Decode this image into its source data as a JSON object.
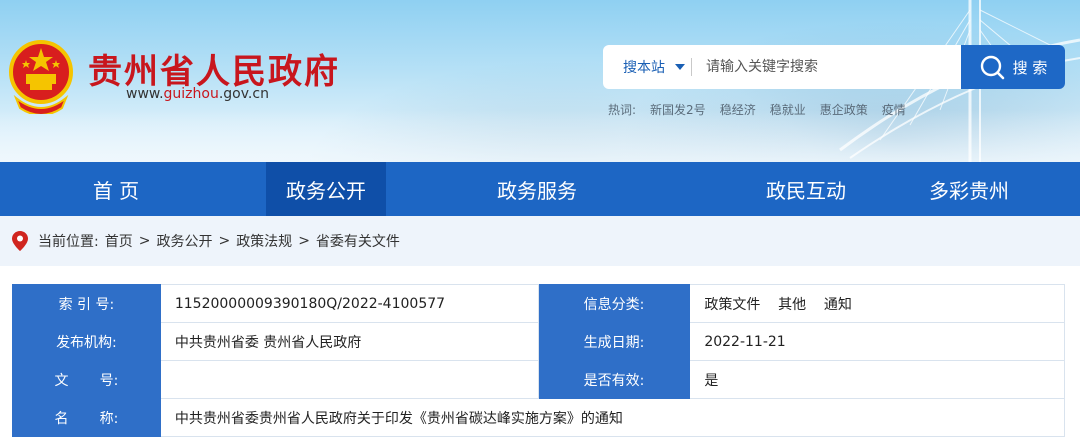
{
  "header": {
    "title": "贵州省人民政府",
    "url_prefix": "www.",
    "url_highlight": "guizhou",
    "url_suffix": ".gov.cn",
    "brand_red": "#c8161d"
  },
  "search": {
    "scope": "搜本站",
    "placeholder": "请输入关键字搜索",
    "button_label": "搜 索",
    "hot_label": "热词:",
    "hot_words": [
      "新国发2号",
      "稳经济",
      "稳就业",
      "惠企政策",
      "疫情"
    ]
  },
  "nav": {
    "items": [
      "首 页",
      "政务公开",
      "政务服务",
      "政民互动",
      "多彩贵州"
    ],
    "active": "政务公开",
    "color": "#1d66c4"
  },
  "breadcrumb": {
    "prefix": "当前位置:",
    "items": [
      "首页",
      "政务公开",
      "政策法规",
      "省委有关文件"
    ],
    "separator": ">"
  },
  "info": {
    "rows": [
      {
        "k1": "索 引 号:",
        "v1": "11520000009390180Q/2022-4100577",
        "k2": "信息分类:",
        "v2": "政策文件    其他    通知"
      },
      {
        "k1": "发布机构:",
        "v1": "中共贵州省委 贵州省人民政府",
        "k2": "生成日期:",
        "v2": "2022-11-21"
      },
      {
        "k1": "文       号:",
        "v1": "",
        "k2": "是否有效:",
        "v2": "是"
      }
    ],
    "name_key": "名       称:",
    "name_value": "中共贵州省委贵州省人民政府关于印发《贵州省碳达峰实施方案》的通知"
  }
}
